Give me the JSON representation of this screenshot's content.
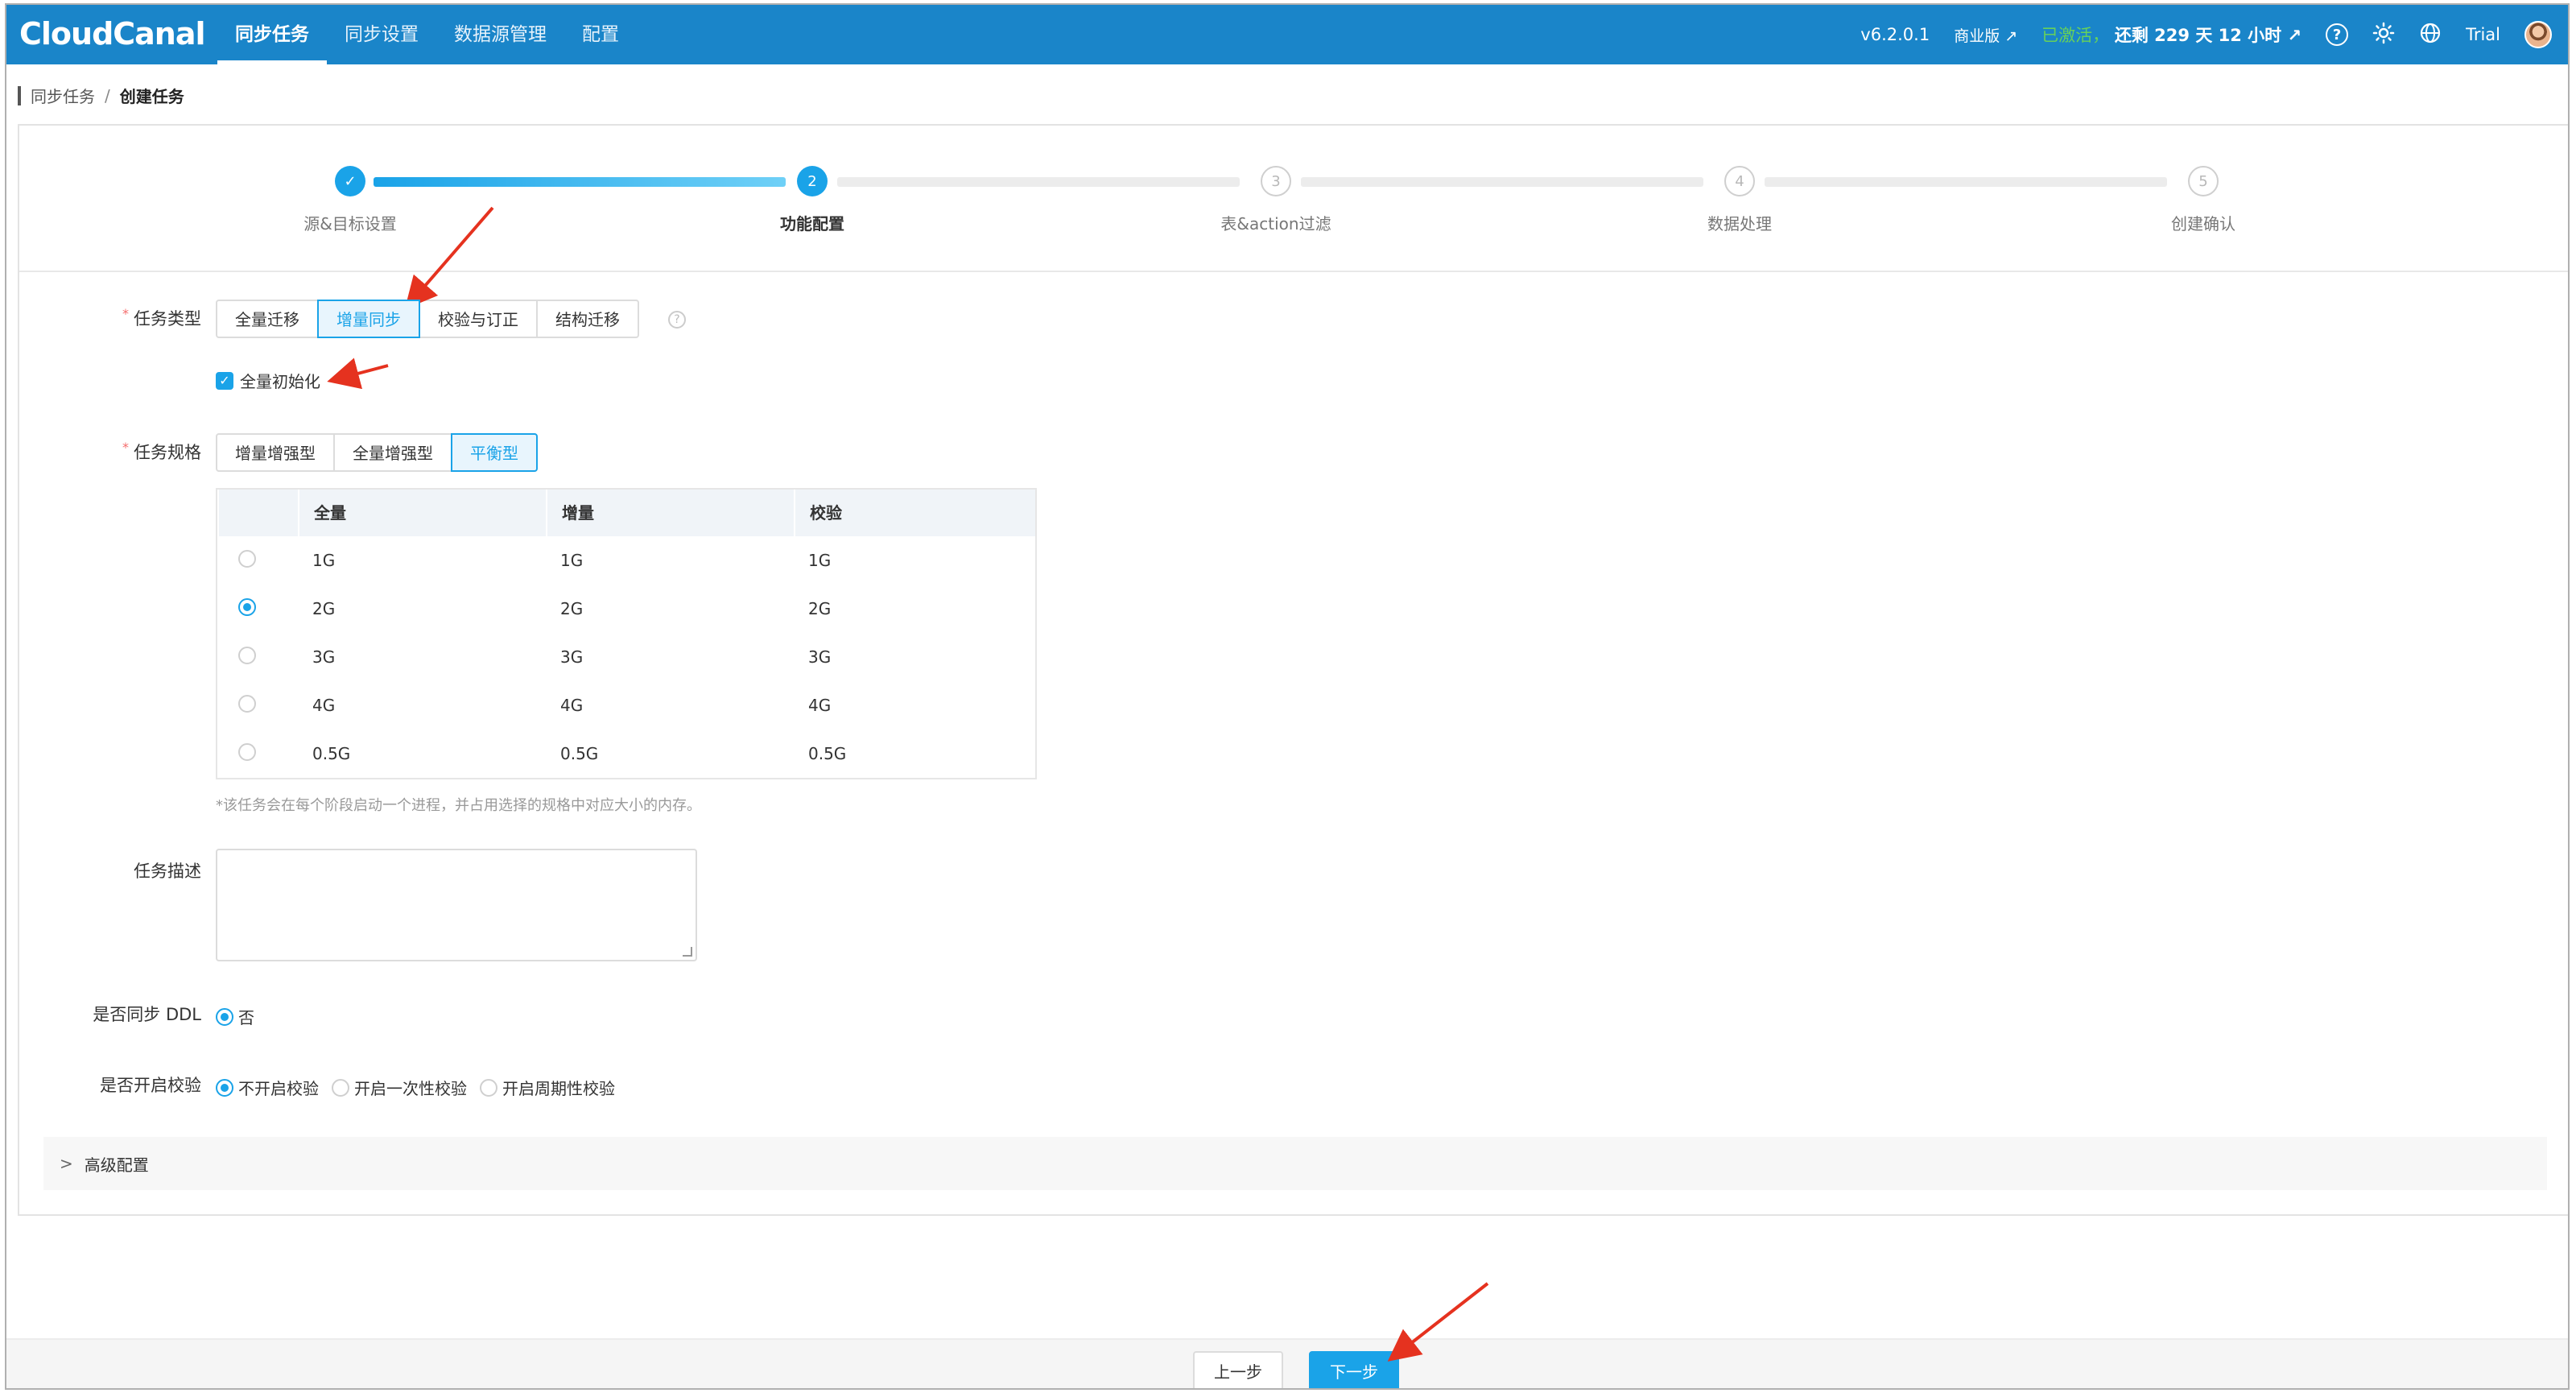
{
  "app": {
    "logo": "CloudCanal",
    "nav": [
      "同步任务",
      "同步设置",
      "数据源管理",
      "配置"
    ],
    "version": "v6.2.0.1",
    "edition": "商业版 ↗",
    "activated": "已激活，",
    "remaining": "还剩 229 天 12 小时 ↗",
    "help_icon": "?",
    "user": "Trial"
  },
  "breadcrumb": {
    "parent": "同步任务",
    "current": "创建任务"
  },
  "steps": {
    "labels": [
      "源&目标设置",
      "功能配置",
      "表&action过滤",
      "数据处理",
      "创建确认"
    ],
    "numbers": [
      "✓",
      "2",
      "3",
      "4",
      "5"
    ],
    "current": 2
  },
  "form": {
    "task_type": {
      "label": "任务类型",
      "options": [
        "全量迁移",
        "增量同步",
        "校验与订正",
        "结构迁移"
      ],
      "selected": "增量同步",
      "help_icon": "?"
    },
    "full_init": {
      "label": "全量初始化",
      "checked": true
    },
    "task_spec": {
      "label": "任务规格",
      "options": [
        "增量增强型",
        "全量增强型",
        "平衡型"
      ],
      "selected": "平衡型",
      "columns": [
        "全量",
        "增量",
        "校验"
      ],
      "rows": [
        [
          "1G",
          "1G",
          "1G"
        ],
        [
          "2G",
          "2G",
          "2G"
        ],
        [
          "3G",
          "3G",
          "3G"
        ],
        [
          "4G",
          "4G",
          "4G"
        ],
        [
          "0.5G",
          "0.5G",
          "0.5G"
        ]
      ],
      "selected_row": 1,
      "note": "*该任务会在每个阶段启动一个进程，并占用选择的规格中对应大小的内存。"
    },
    "description": {
      "label": "任务描述",
      "value": ""
    },
    "sync_ddl": {
      "label": "是否同步 DDL",
      "options": [
        "否"
      ],
      "selected": "否"
    },
    "verify": {
      "label": "是否开启校验",
      "options": [
        "不开启校验",
        "开启一次性校验",
        "开启周期性校验"
      ],
      "selected": "不开启校验"
    },
    "advanced": {
      "label": "高级配置"
    }
  },
  "footer": {
    "prev": "上一步",
    "next": "下一步"
  },
  "colors": {
    "primary": "#1aa3e8",
    "topbar": "#1a85c9",
    "activated": "#67d15a",
    "annotation": "#e5321f"
  }
}
